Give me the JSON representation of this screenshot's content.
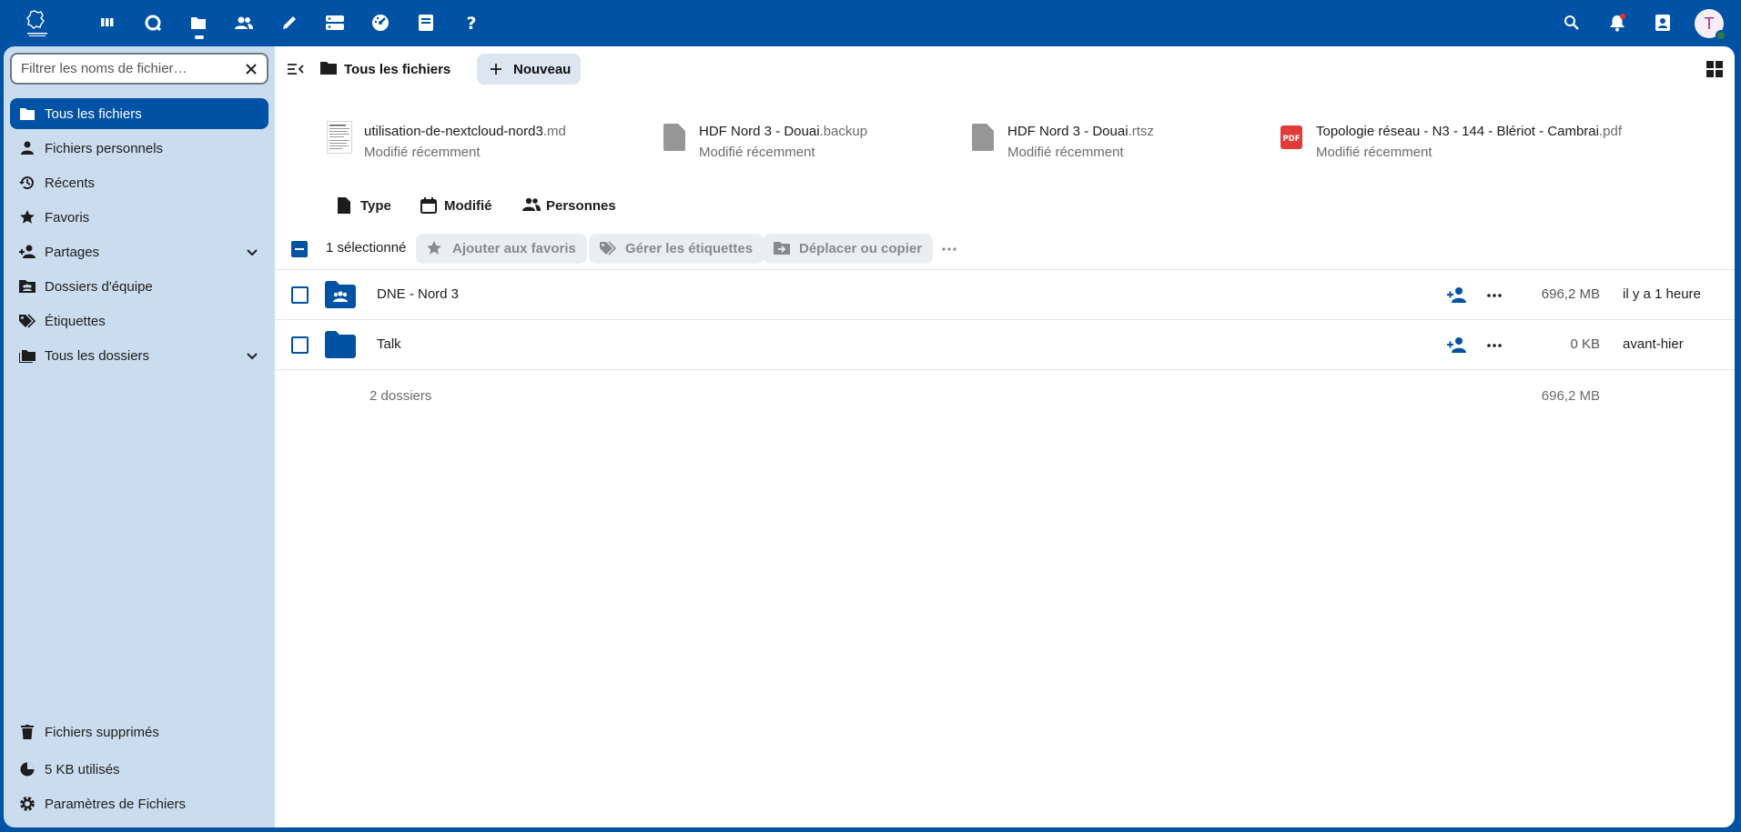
{
  "header": {
    "apps": [
      {
        "name": "Tableau de bord",
        "icon": "dashboard-icon"
      },
      {
        "name": "Talk",
        "icon": "talk-icon"
      },
      {
        "name": "Fichiers",
        "icon": "files-icon"
      },
      {
        "name": "Contacts",
        "icon": "contacts-icon"
      },
      {
        "name": "Notes",
        "icon": "pencil-icon"
      },
      {
        "name": "Stockage",
        "icon": "storage-icon"
      },
      {
        "name": "Tableau de bord",
        "icon": "gauge-icon"
      },
      {
        "name": "Documentation",
        "icon": "book-icon"
      },
      {
        "name": "Aide",
        "icon": "help-icon"
      }
    ],
    "active_app": "Fichiers",
    "avatar_initial": "T",
    "avatar_status_color": "#2d7b41"
  },
  "sidebar": {
    "filter_placeholder": "Filtrer les noms de fichier…",
    "items": [
      {
        "label": "Tous les fichiers",
        "icon": "folder-icon",
        "active": true
      },
      {
        "label": "Fichiers personnels",
        "icon": "person-icon"
      },
      {
        "label": "Récents",
        "icon": "history-icon"
      },
      {
        "label": "Favoris",
        "icon": "star-icon"
      },
      {
        "label": "Partages",
        "icon": "share-icon",
        "expandable": true
      },
      {
        "label": "Dossiers d'équipe",
        "icon": "team-folder-icon"
      },
      {
        "label": "Étiquettes",
        "icon": "tag-icon"
      },
      {
        "label": "Tous les dossiers",
        "icon": "folders-icon",
        "expandable": true
      }
    ],
    "footer": [
      {
        "label": "Fichiers supprimés",
        "icon": "trash-icon"
      },
      {
        "label": "5 KB utilisés",
        "icon": "pie-chart-icon"
      },
      {
        "label": "Paramètres de Fichiers",
        "icon": "settings-icon"
      }
    ]
  },
  "toolbar": {
    "breadcrumb": "Tous les fichiers",
    "new_label": "Nouveau"
  },
  "recent_files": [
    {
      "name": "utilisation-de-nextcloud-nord3",
      "ext": ".md",
      "subtitle": "Modifié récemment",
      "icon": "document-thumbnail-icon"
    },
    {
      "name": "HDF Nord 3 - Douai",
      "ext": ".backup",
      "subtitle": "Modifié récemment",
      "icon": "file-icon"
    },
    {
      "name": "HDF Nord 3 - Douai",
      "ext": ".rtsz",
      "subtitle": "Modifié récemment",
      "icon": "file-icon"
    },
    {
      "name": "Topologie réseau - N3 - 144 - Blériot - Cambrai",
      "ext": ".pdf",
      "subtitle": "Modifié récemment",
      "icon": "pdf-icon"
    }
  ],
  "filters": [
    {
      "label": "Type",
      "icon": "file-type-icon"
    },
    {
      "label": "Modifié",
      "icon": "calendar-icon"
    },
    {
      "label": "Personnes",
      "icon": "people-icon"
    }
  ],
  "selection": {
    "count_label": "1 sélectionné",
    "actions": [
      {
        "label": "Ajouter aux favoris",
        "icon": "star-icon"
      },
      {
        "label": "Gérer les étiquettes",
        "icon": "tag-icon"
      },
      {
        "label": "Déplacer ou copier",
        "icon": "move-icon"
      }
    ],
    "more": "…"
  },
  "files": [
    {
      "name": "DNE - Nord 3",
      "type": "group-folder",
      "size": "696,2 MB",
      "modified": "il y a 1 heure"
    },
    {
      "name": "Talk",
      "type": "folder",
      "size": "0 KB",
      "modified": "avant-hier"
    }
  ],
  "summary": {
    "label": "2 dossiers",
    "size": "696,2 MB"
  },
  "colors": {
    "brand": "#0052a5",
    "sidebar_bg": "#cbdcee",
    "pdf_red": "#e23b37"
  }
}
